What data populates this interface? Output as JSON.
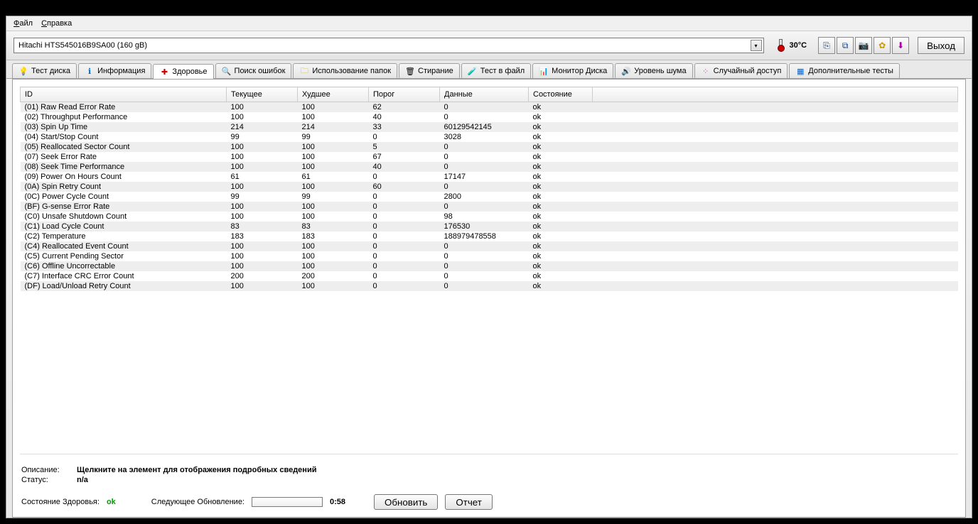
{
  "menu": {
    "file": "Файл",
    "help": "Справка"
  },
  "drive_name": "Hitachi HTS545016B9SA00 (160 gB)",
  "temperature": "30°C",
  "exit_label": "Выход",
  "tabs": {
    "disk_test": "Тест диска",
    "info": "Информация",
    "health": "Здоровье",
    "scan_errors": "Поиск ошибок",
    "folder_usage": "Использование папок",
    "erase": "Стирание",
    "file_test": "Тест в файл",
    "disk_monitor": "Монитор Диска",
    "noise": "Уровень шума",
    "random_access": "Случайный доступ",
    "additional": "Дополнительные тесты"
  },
  "columns": {
    "id": "ID",
    "current": "Текущее",
    "worst": "Худшее",
    "threshold": "Порог",
    "data": "Данные",
    "state": "Состояние"
  },
  "rows": [
    {
      "id": "(01) Raw Read Error Rate",
      "cur": "100",
      "worst": "100",
      "th": "62",
      "data": "0",
      "st": "ok"
    },
    {
      "id": "(02) Throughput Performance",
      "cur": "100",
      "worst": "100",
      "th": "40",
      "data": "0",
      "st": "ok"
    },
    {
      "id": "(03) Spin Up Time",
      "cur": "214",
      "worst": "214",
      "th": "33",
      "data": "60129542145",
      "st": "ok"
    },
    {
      "id": "(04) Start/Stop Count",
      "cur": "99",
      "worst": "99",
      "th": "0",
      "data": "3028",
      "st": "ok"
    },
    {
      "id": "(05) Reallocated Sector Count",
      "cur": "100",
      "worst": "100",
      "th": "5",
      "data": "0",
      "st": "ok"
    },
    {
      "id": "(07) Seek Error Rate",
      "cur": "100",
      "worst": "100",
      "th": "67",
      "data": "0",
      "st": "ok"
    },
    {
      "id": "(08) Seek Time Performance",
      "cur": "100",
      "worst": "100",
      "th": "40",
      "data": "0",
      "st": "ok"
    },
    {
      "id": "(09) Power On Hours Count",
      "cur": "61",
      "worst": "61",
      "th": "0",
      "data": "17147",
      "st": "ok"
    },
    {
      "id": "(0A) Spin Retry Count",
      "cur": "100",
      "worst": "100",
      "th": "60",
      "data": "0",
      "st": "ok"
    },
    {
      "id": "(0C) Power Cycle Count",
      "cur": "99",
      "worst": "99",
      "th": "0",
      "data": "2800",
      "st": "ok"
    },
    {
      "id": "(BF) G-sense Error Rate",
      "cur": "100",
      "worst": "100",
      "th": "0",
      "data": "0",
      "st": "ok"
    },
    {
      "id": "(C0) Unsafe Shutdown Count",
      "cur": "100",
      "worst": "100",
      "th": "0",
      "data": "98",
      "st": "ok"
    },
    {
      "id": "(C1) Load Cycle Count",
      "cur": "83",
      "worst": "83",
      "th": "0",
      "data": "176530",
      "st": "ok"
    },
    {
      "id": "(C2) Temperature",
      "cur": "183",
      "worst": "183",
      "th": "0",
      "data": "188979478558",
      "st": "ok"
    },
    {
      "id": "(C4) Reallocated Event Count",
      "cur": "100",
      "worst": "100",
      "th": "0",
      "data": "0",
      "st": "ok"
    },
    {
      "id": "(C5) Current Pending Sector",
      "cur": "100",
      "worst": "100",
      "th": "0",
      "data": "0",
      "st": "ok"
    },
    {
      "id": "(C6) Offline Uncorrectable",
      "cur": "100",
      "worst": "100",
      "th": "0",
      "data": "0",
      "st": "ok"
    },
    {
      "id": "(C7) Interface CRC Error Count",
      "cur": "200",
      "worst": "200",
      "th": "0",
      "data": "0",
      "st": "ok"
    },
    {
      "id": "(DF) Load/Unload Retry Count",
      "cur": "100",
      "worst": "100",
      "th": "0",
      "data": "0",
      "st": "ok"
    }
  ],
  "footer": {
    "desc_label": "Описание:",
    "desc_value": "Щелкните на элемент для отображения подробных сведений",
    "status_label": "Статус:",
    "status_value": "n/a",
    "health_label": "Состояние Здоровья:",
    "health_value": "ok",
    "next_update_label": "Следующее Обновление:",
    "timer": "0:58",
    "refresh": "Обновить",
    "report": "Отчет"
  }
}
